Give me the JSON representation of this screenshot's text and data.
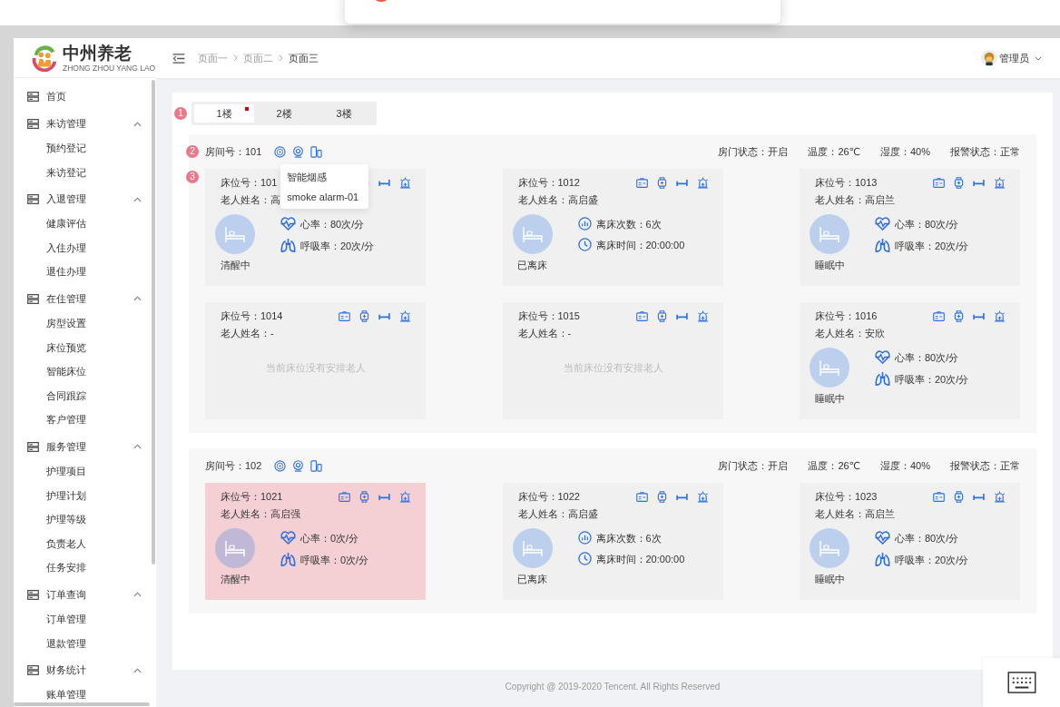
{
  "brand": {
    "name": "中州养老",
    "subtitle": "ZHONG ZHOU YANG LAO"
  },
  "sidebar": {
    "items": [
      {
        "label": "首页"
      },
      {
        "label": "来访管理",
        "expanded": true,
        "children": [
          {
            "label": "预约登记"
          },
          {
            "label": "来访登记"
          }
        ]
      },
      {
        "label": "入退管理",
        "expanded": true,
        "children": [
          {
            "label": "健康评估"
          },
          {
            "label": "入住办理"
          },
          {
            "label": "退住办理"
          }
        ]
      },
      {
        "label": "在住管理",
        "expanded": true,
        "children": [
          {
            "label": "房型设置"
          },
          {
            "label": "床位预览"
          },
          {
            "label": "智能床位"
          },
          {
            "label": "合同跟踪"
          },
          {
            "label": "客户管理"
          }
        ]
      },
      {
        "label": "服务管理",
        "expanded": true,
        "children": [
          {
            "label": "护理项目"
          },
          {
            "label": "护理计划"
          },
          {
            "label": "护理等级"
          },
          {
            "label": "负责老人"
          },
          {
            "label": "任务安排"
          }
        ]
      },
      {
        "label": "订单查询",
        "expanded": true,
        "children": [
          {
            "label": "订单管理"
          },
          {
            "label": "退款管理"
          }
        ]
      },
      {
        "label": "财务统计",
        "expanded": true,
        "children": [
          {
            "label": "账单管理"
          }
        ]
      }
    ]
  },
  "breadcrumb": [
    "页面一",
    "页面二",
    "页面三"
  ],
  "user": {
    "name": "管理员"
  },
  "floor_tabs": {
    "marker": "1",
    "tabs": [
      {
        "label": "1楼",
        "selected": true,
        "dot": true
      },
      {
        "label": "2楼",
        "selected": false,
        "dot": false
      },
      {
        "label": "3楼",
        "selected": false,
        "dot": false
      }
    ]
  },
  "rooms": [
    {
      "marker": "2",
      "cards_marker": "3",
      "label": "房间号：101",
      "status": [
        "房门状态：开启",
        "温度：26℃",
        "湿度：40%",
        "报警状态：正常"
      ],
      "tooltip": {
        "title": "智能烟感",
        "text": "smoke alarm-01"
      },
      "beds": [
        {
          "kind": "occupied",
          "alert": false,
          "bed_label": "床位号：101",
          "name_label": "老人姓名：高",
          "status": "清醒中",
          "metrics": [
            {
              "kind": "heart",
              "text": "心率：80次/分"
            },
            {
              "kind": "lungs",
              "text": "呼吸率：20次/分"
            }
          ]
        },
        {
          "kind": "occupied",
          "alert": false,
          "bed_label": "床位号：1012",
          "name_label": "老人姓名：高启盛",
          "status": "已离床",
          "metrics": [
            {
              "kind": "count",
              "text": "离床次数：6次"
            },
            {
              "kind": "clock",
              "text": "离床时间：20:00:00"
            }
          ]
        },
        {
          "kind": "occupied",
          "alert": false,
          "bed_label": "床位号：1013",
          "name_label": "老人姓名：高启兰",
          "status": "睡眠中",
          "metrics": [
            {
              "kind": "heart",
              "text": "心率：80次/分"
            },
            {
              "kind": "lungs",
              "text": "呼吸率：20次/分"
            }
          ]
        },
        {
          "kind": "empty",
          "alert": false,
          "bed_label": "床位号：1014",
          "name_label": "老人姓名：-",
          "message": "当前床位没有安排老人"
        },
        {
          "kind": "empty",
          "alert": false,
          "bed_label": "床位号：1015",
          "name_label": "老人姓名：-",
          "message": "当前床位没有安排老人"
        },
        {
          "kind": "occupied",
          "alert": false,
          "bed_label": "床位号：1016",
          "name_label": "老人姓名：安欣",
          "status": "睡眠中",
          "metrics": [
            {
              "kind": "heart",
              "text": "心率：80次/分"
            },
            {
              "kind": "lungs",
              "text": "呼吸率：20次/分"
            }
          ]
        }
      ]
    },
    {
      "label": "房间号：102",
      "status": [
        "房门状态：开启",
        "温度：26℃",
        "湿度：40%",
        "报警状态：正常"
      ],
      "beds": [
        {
          "kind": "occupied",
          "alert": true,
          "bed_label": "床位号：1021",
          "name_label": "老人姓名：高启强",
          "status": "清醒中",
          "metrics": [
            {
              "kind": "heart",
              "text": "心率：0次/分"
            },
            {
              "kind": "lungs",
              "text": "呼吸率：0次/分"
            }
          ]
        },
        {
          "kind": "occupied",
          "alert": false,
          "bed_label": "床位号：1022",
          "name_label": "老人姓名：高启盛",
          "status": "已离床",
          "metrics": [
            {
              "kind": "count",
              "text": "离床次数：6次"
            },
            {
              "kind": "clock",
              "text": "离床时间：20:00:00"
            }
          ]
        },
        {
          "kind": "occupied",
          "alert": false,
          "bed_label": "床位号：1023",
          "name_label": "老人姓名：高启兰",
          "status": "睡眠中",
          "metrics": [
            {
              "kind": "heart",
              "text": "心率：80次/分"
            },
            {
              "kind": "lungs",
              "text": "呼吸率：20次/分"
            }
          ]
        }
      ]
    }
  ],
  "footer": "Copyright @ 2019-2020 Tencent. All Rights Reserved"
}
